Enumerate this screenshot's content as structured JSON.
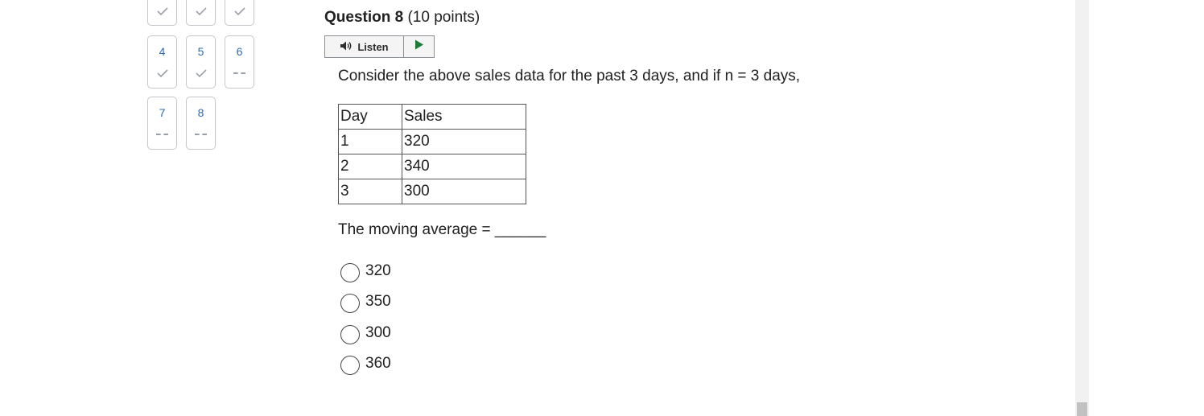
{
  "navigator": {
    "row0": [
      {
        "status": "answered"
      },
      {
        "status": "answered"
      },
      {
        "status": "answered"
      }
    ],
    "row1": [
      {
        "number": "4",
        "status": "answered"
      },
      {
        "number": "5",
        "status": "answered"
      },
      {
        "number": "6",
        "status": "unanswered"
      }
    ],
    "row2": [
      {
        "number": "7",
        "status": "unanswered"
      },
      {
        "number": "8",
        "status": "unanswered"
      }
    ]
  },
  "question": {
    "title": "Question 8",
    "points": "(10 points)",
    "listen_label": "Listen",
    "prompt": "Consider the above sales data for the past 3 days, and if n = 3 days,",
    "table": {
      "headers": [
        "Day",
        "Sales"
      ],
      "rows": [
        [
          "1",
          "320"
        ],
        [
          "2",
          "340"
        ],
        [
          "3",
          "300"
        ]
      ]
    },
    "moving_average_text": "The moving average = ______",
    "options": [
      "320",
      "350",
      "300",
      "360"
    ]
  },
  "colors": {
    "link_blue": "#2a6bb5",
    "check_gray": "#9aa0a8",
    "play_green": "#1e7a3a"
  }
}
